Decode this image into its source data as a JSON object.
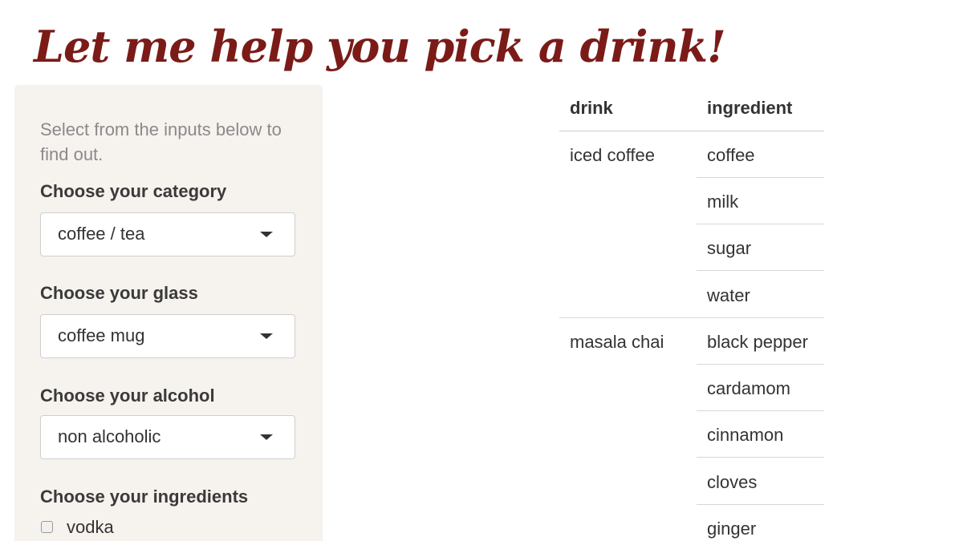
{
  "page": {
    "title": "Let me help you pick a drink!"
  },
  "sidebar": {
    "help_text": "Select from the inputs below to find out.",
    "category": {
      "label": "Choose your category",
      "selected": "coffee / tea"
    },
    "glass": {
      "label": "Choose your glass",
      "selected": "coffee mug"
    },
    "alcohol": {
      "label": "Choose your alcohol",
      "selected": "non alcoholic"
    },
    "ingredients": {
      "label": "Choose your ingredients",
      "options": [
        {
          "label": "vodka",
          "checked": false
        }
      ]
    }
  },
  "results": {
    "columns": [
      "drink",
      "ingredient"
    ],
    "drinks": [
      {
        "name": "iced coffee",
        "ingredients": [
          "coffee",
          "milk",
          "sugar",
          "water"
        ]
      },
      {
        "name": "masala chai",
        "ingredients": [
          "black pepper",
          "cardamom",
          "cinnamon",
          "cloves",
          "ginger"
        ]
      }
    ]
  },
  "colors": {
    "title": "#7b1b18",
    "sidebar_background": "#f6f2ee",
    "help_text": "#8a8a8a",
    "text": "#333333"
  }
}
